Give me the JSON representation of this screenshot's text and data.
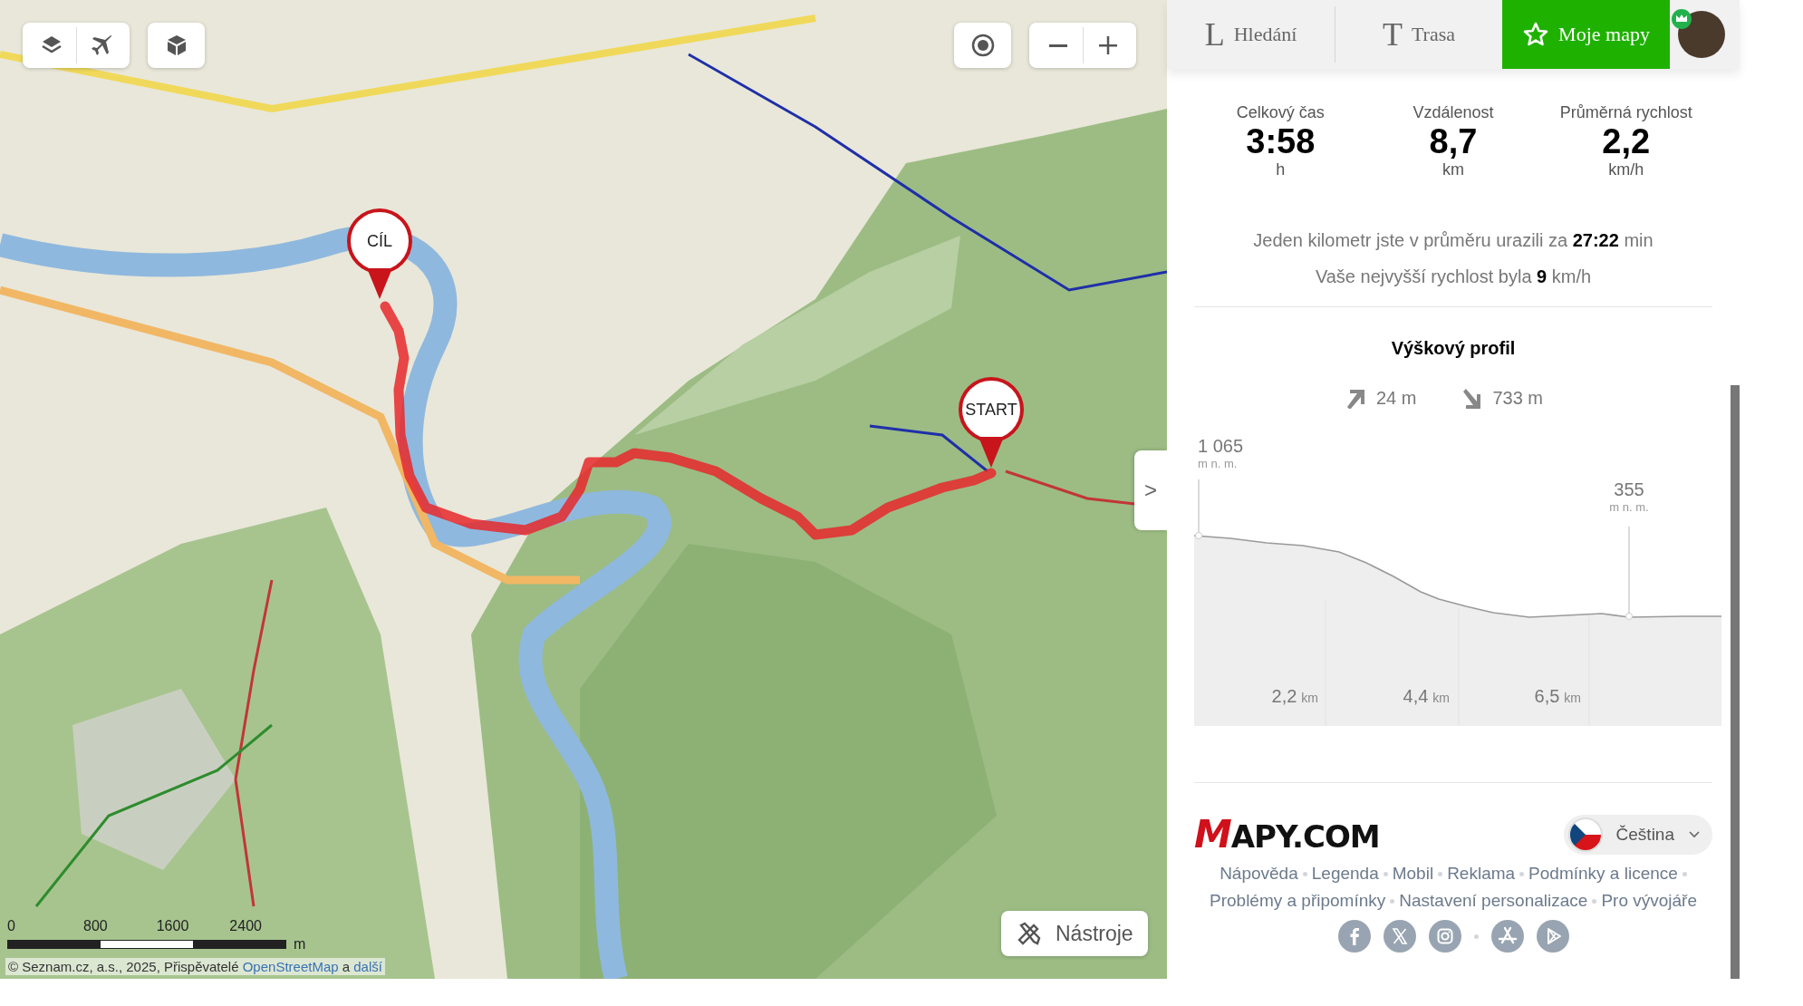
{
  "map": {
    "controls": [
      {
        "kind": "layers"
      },
      {
        "kind": "flight"
      },
      {
        "kind": "cube"
      }
    ],
    "controls_right": [
      {
        "kind": "locate"
      },
      {
        "kind": "zoom-out"
      },
      {
        "kind": "zoom-in"
      }
    ],
    "markers": [
      {
        "kind": "finish",
        "label": "CÍL"
      },
      {
        "kind": "start",
        "label": "START"
      }
    ],
    "side_toggle": ">",
    "tools_button": "Nástroje",
    "scale": {
      "ticks": [
        "0",
        "800",
        "1600",
        "2400"
      ],
      "unit": "m"
    },
    "attribution": {
      "text": "© Seznam.cz, a.s., 2025, Přispěvatelé ",
      "link": "OpenStreetMap",
      "joiner": " a ",
      "link2": "další"
    }
  },
  "tabs": [
    {
      "kind": "glyph",
      "glyph": "L",
      "label": "Hledání",
      "selected": false
    },
    {
      "kind": "glyph",
      "glyph": "T",
      "label": "Trasa",
      "selected": false
    },
    {
      "kind": "star",
      "label": "Moje mapy",
      "selected": true
    }
  ],
  "stats": [
    {
      "label": "Celkový čas",
      "value": "3:58",
      "unit": "h"
    },
    {
      "label": "Vzdálenost",
      "value": "8,7",
      "unit": "km"
    },
    {
      "label": "Průměrná rychlost",
      "value": "2,2",
      "unit": "km/h"
    }
  ],
  "summary": [
    "Jeden kilometr jste v průměru urazili za **27:22** min",
    "Vaše nejvyšší rychlost byla **9** km/h"
  ],
  "profile": {
    "title": "Výškový profil",
    "ascent": "24 m",
    "descent": "733 m",
    "max": {
      "value": "1 065",
      "unit": "m n. m."
    },
    "min": {
      "value": "355",
      "unit": "m n. m."
    },
    "distances": [
      {
        "value": "2,2",
        "unit": "km"
      },
      {
        "value": "4,4",
        "unit": "km"
      },
      {
        "value": "6,5",
        "unit": "km"
      }
    ]
  },
  "footer": {
    "logo": {
      "initial": "M",
      "rest": "APY.COM"
    },
    "language": "Čeština",
    "link_rows": [
      [
        "Nápověda",
        "Legenda",
        "Mobil",
        "Reklama",
        "Podmínky a licence"
      ],
      [
        "Problémy a připomínky",
        "Nastavení personalizace",
        "Pro vývojáře"
      ]
    ],
    "social": [
      {
        "kind": "facebook"
      },
      {
        "kind": "x"
      },
      {
        "kind": "instagram"
      },
      {
        "kind": "separator"
      },
      {
        "kind": "appstore"
      },
      {
        "kind": "googleplay"
      }
    ]
  }
}
